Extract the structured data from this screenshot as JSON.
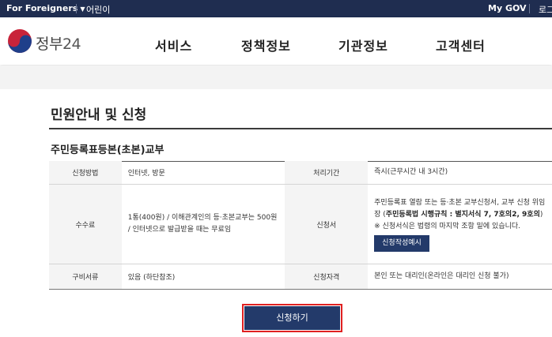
{
  "topbar": {
    "foreigners": "For Foreigners",
    "kids": "어린이",
    "mygov": "My GOV",
    "login": "로그"
  },
  "header": {
    "logo_text": "정부",
    "logo_num": "24",
    "nav": [
      "서비스",
      "정책정보",
      "기관정보",
      "고객센터"
    ]
  },
  "page": {
    "title": "민원안내 및 신청",
    "subtitle": "주민등록표등본(초본)교부"
  },
  "table": {
    "row1": {
      "label1": "신청방법",
      "value1": "인터넷, 방문",
      "label2": "처리기간",
      "value2": "즉시(근무시간 내 3시간)"
    },
    "row2": {
      "label1": "수수료",
      "value1": "1통(400원) / 이해관계인의 등·초본교부는 500원 / 인터넷으로 발급받을 때는 무료임",
      "label2": "신청서",
      "value2_a": "주민등록표 열람 또는 등·초본 교부신청서, 교부 신청 위임장 (",
      "value2_bold": "주민등록법 시행규칙 : 별지서식 7, 7호의2, 9호의",
      "value2_b": ")",
      "value2_note": "※ 신청서식은 법령의 마지막 조항 밑에 있습니다.",
      "example_button": "신청작성예시"
    },
    "row3": {
      "label1": "구비서류",
      "value1": "있음 (하단참조)",
      "label2": "신청자격",
      "value2": "본인 또는 대리인(온라인은 대리인 신청 불가)"
    }
  },
  "apply_button": "신청하기",
  "colors": {
    "topbar_bg": "#1f2d50",
    "button_bg": "#233a6a",
    "highlight": "#e02020"
  }
}
